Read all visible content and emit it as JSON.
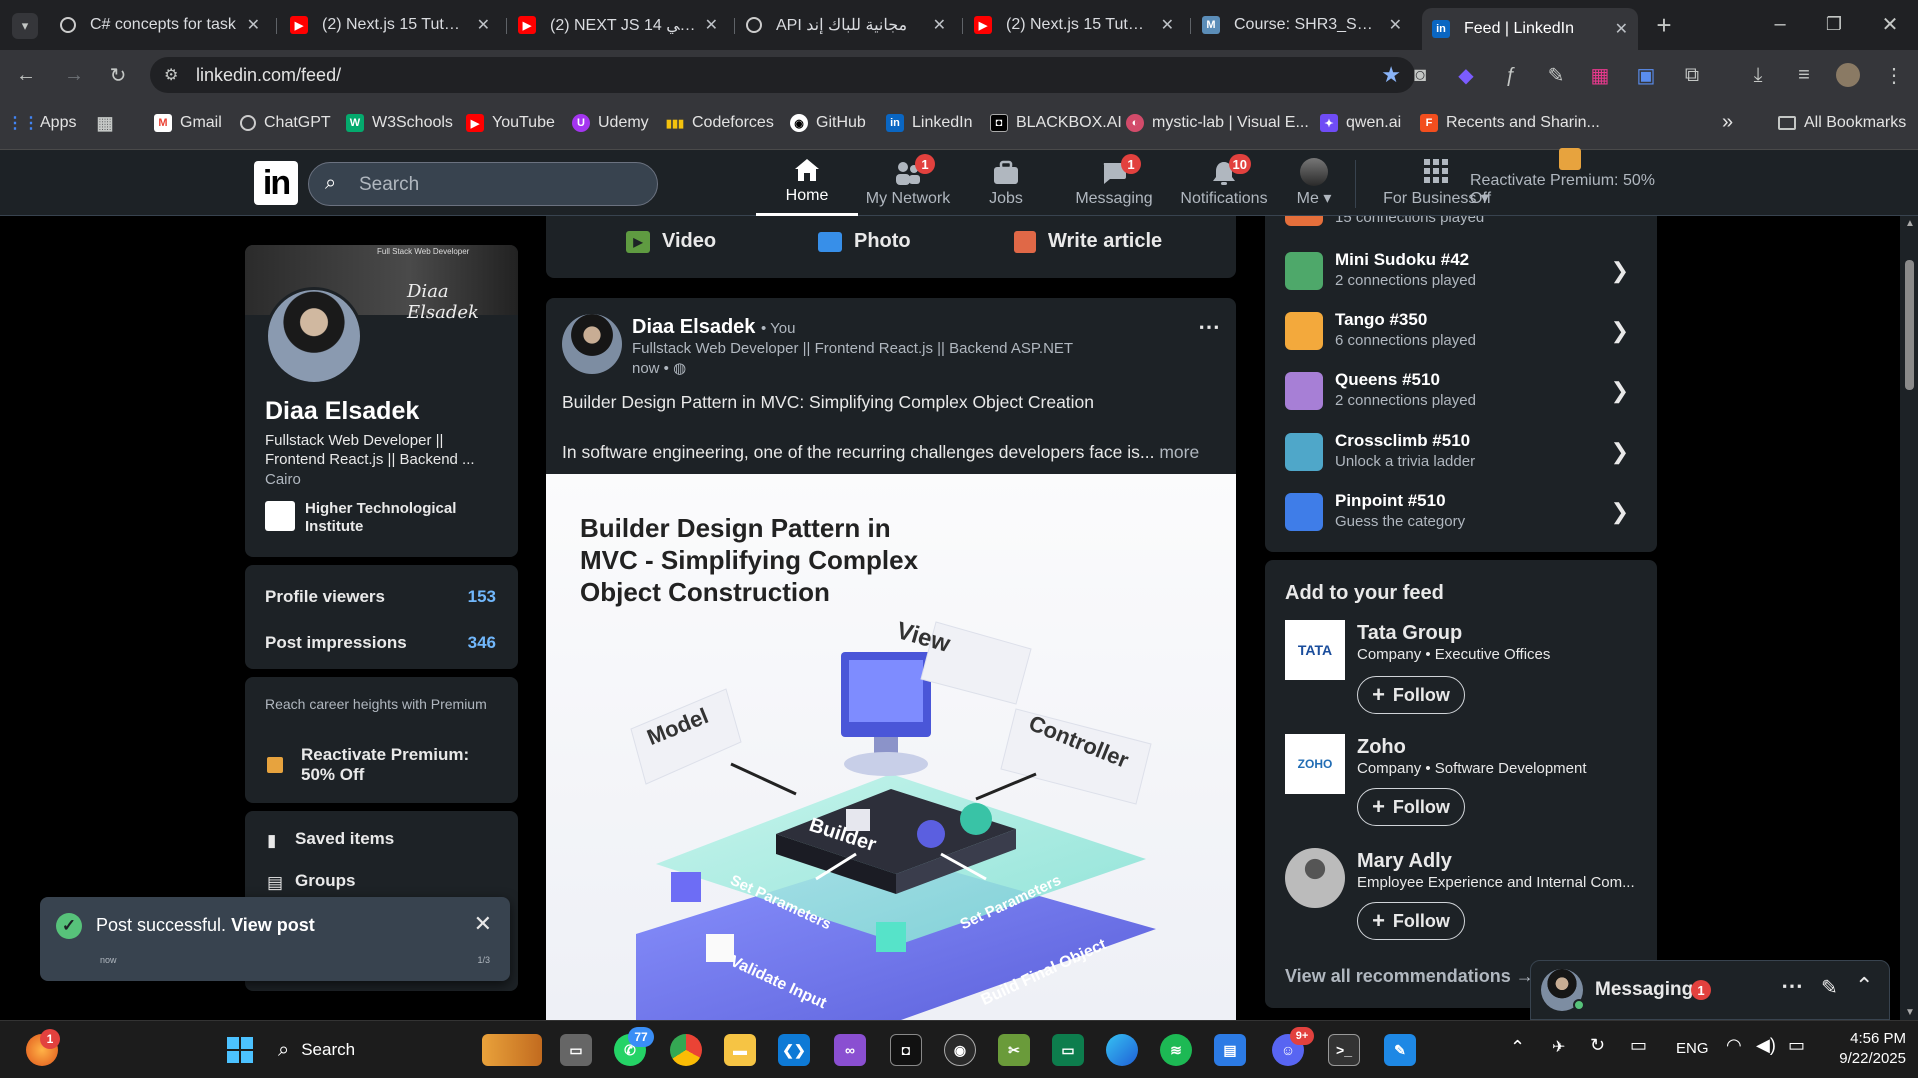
{
  "browser": {
    "tabs": [
      {
        "title": "C# concepts for task",
        "icon": "chatgpt-icon"
      },
      {
        "title": "(2) Next.js 15 Tutorial",
        "icon": "youtube-icon"
      },
      {
        "title": "(2) NEXT JS 14 العربي",
        "icon": "youtube-icon"
      },
      {
        "title": "API مجانية للباك إند",
        "icon": "chatgpt-icon"
      },
      {
        "title": "(2) Next.js 15 Tutorial",
        "icon": "youtube-icon"
      },
      {
        "title": "Course: SHR3_SWD5",
        "icon": "moodle-icon"
      },
      {
        "title": "Feed | LinkedIn",
        "icon": "linkedin-icon"
      }
    ],
    "url": "linkedin.com/feed/",
    "bookmarks": [
      "Apps",
      "Gmail",
      "ChatGPT",
      "W3Schools",
      "YouTube",
      "Udemy",
      "Codeforces",
      "GitHub",
      "LinkedIn",
      "BLACKBOX.AI",
      "mystic-lab | Visual E...",
      "qwen.ai",
      "Recents and Sharin..."
    ],
    "all_bookmarks": "All Bookmarks"
  },
  "linkedin": {
    "search_placeholder": "Search",
    "nav": [
      {
        "label": "Home",
        "badge": ""
      },
      {
        "label": "My Network",
        "badge": "1"
      },
      {
        "label": "Jobs",
        "badge": ""
      },
      {
        "label": "Messaging",
        "badge": "1"
      },
      {
        "label": "Notifications",
        "badge": "10"
      },
      {
        "label": "Me",
        "badge": ""
      },
      {
        "label": "For Business",
        "badge": ""
      },
      {
        "label": "Reactivate Premium: 50% Off",
        "badge": ""
      }
    ]
  },
  "profile": {
    "banner_text": "Diaa Elsadek",
    "banner_tag": "Full Stack Web Developer",
    "name": "Diaa Elsadek",
    "headline": "Fullstack Web Developer || Frontend React.js || Backend ...",
    "location": "Cairo",
    "institute": "Higher Technological Institute",
    "stats": [
      {
        "label": "Profile viewers",
        "value": "153"
      },
      {
        "label": "Post impressions",
        "value": "346"
      }
    ],
    "premium_prompt": "Reach career heights with Premium",
    "premium_cta": "Reactivate Premium: 50% Off",
    "links": [
      "Saved items",
      "Groups"
    ]
  },
  "toast": {
    "text": "Post successful.",
    "link": "View post",
    "time": "now",
    "counter": "1/3"
  },
  "composer": {
    "actions": [
      "Video",
      "Photo",
      "Write article"
    ]
  },
  "post": {
    "author": "Diaa Elsadek",
    "you": "• You",
    "headline": "Fullstack Web Developer || Frontend React.js || Backend ASP.NET",
    "time": "now •",
    "title": "Builder Design Pattern in MVC: Simplifying Complex Object Creation",
    "excerpt": "In software engineering, one of the recurring challenges developers face is...",
    "more": "more",
    "image": {
      "heading": "Builder Design Pattern in MVC - Simplifying Complex Object Construction",
      "labels": [
        "View",
        "Model",
        "Controller",
        "Builder",
        "Set Parameters",
        "Set Parameters",
        "Validate Input",
        "Build Final Object"
      ]
    }
  },
  "games": {
    "partial_sub": "15 connections played",
    "items": [
      {
        "title": "Mini Sudoku #42",
        "sub": "2 connections played",
        "color": "#4ea86a"
      },
      {
        "title": "Tango #350",
        "sub": "6 connections played",
        "color": "#f3a93c"
      },
      {
        "title": "Queens #510",
        "sub": "2 connections played",
        "color": "#a77fd6"
      },
      {
        "title": "Crossclimb #510",
        "sub": "Unlock a trivia ladder",
        "color": "#4fa7c9"
      },
      {
        "title": "Pinpoint #510",
        "sub": "Guess the category",
        "color": "#3f7de8"
      }
    ]
  },
  "feed_suggestions": {
    "title": "Add to your feed",
    "items": [
      {
        "name": "Tata Group",
        "sub": "Company • Executive Offices",
        "button": "Follow",
        "logo": "TATA"
      },
      {
        "name": "Zoho",
        "sub": "Company • Software Development",
        "button": "Follow",
        "logo": "ZOHO"
      },
      {
        "name": "Mary Adly",
        "sub": "Employee Experience and Internal Com...",
        "button": "Follow",
        "logo": ""
      }
    ],
    "view_all": "View all recommendations →"
  },
  "messaging": {
    "label": "Messaging",
    "badge": "1"
  },
  "taskbar": {
    "search": "Search",
    "lang": "ENG",
    "time": "4:56 PM",
    "date": "9/22/2025",
    "whatsapp_badge": "77",
    "discord_badge": "9+",
    "start_badge": "1"
  }
}
